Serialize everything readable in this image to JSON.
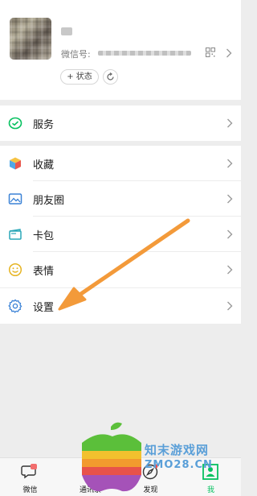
{
  "profile": {
    "wechat_id_label": "微信号:",
    "status_button": "+ 状态"
  },
  "groups": {
    "service": {
      "label": "服务"
    },
    "favorites": {
      "label": "收藏"
    },
    "moments": {
      "label": "朋友圈"
    },
    "cards": {
      "label": "卡包"
    },
    "stickers": {
      "label": "表情"
    },
    "settings": {
      "label": "设置"
    }
  },
  "tabbar": {
    "chats": "微信",
    "contacts": "通讯录",
    "discover": "发现",
    "me": "我"
  },
  "watermark": {
    "text_cn": "知末游戏网",
    "text_en": "ZMO28.CN"
  },
  "colors": {
    "brand_green": "#07c160",
    "arrow_orange": "#f39a3a",
    "background": "#ededed"
  }
}
